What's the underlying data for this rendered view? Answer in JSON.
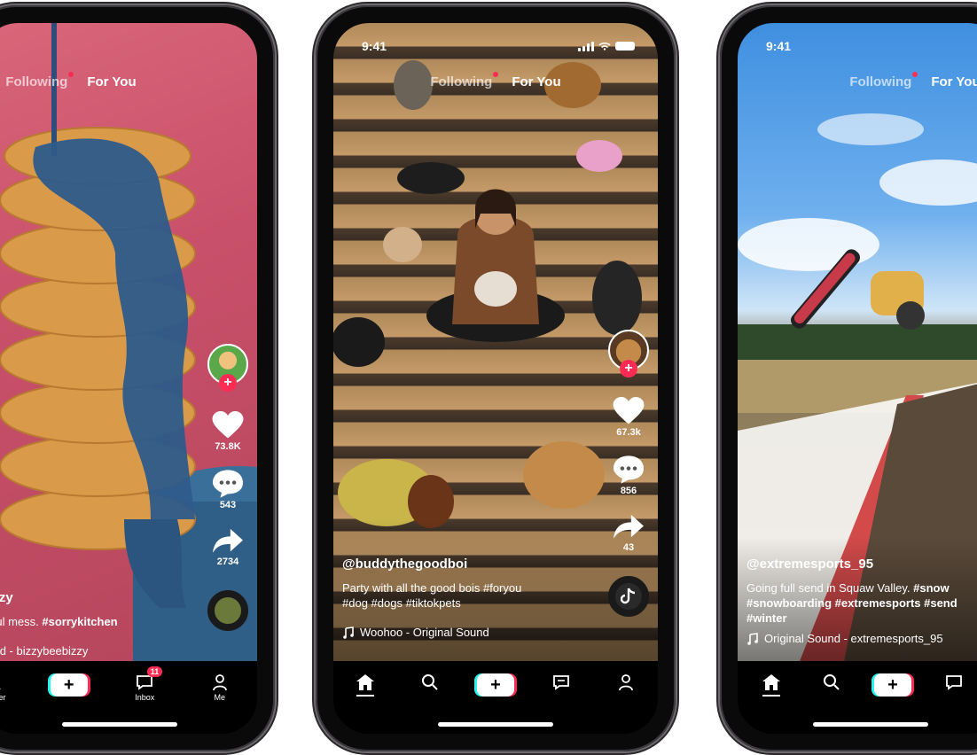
{
  "phones": [
    {
      "nav": {
        "following": "Following",
        "for_you": "For You"
      },
      "rail": {
        "likes": "73.8K",
        "comments": "543",
        "shares": "2734"
      },
      "caption": {
        "handle": "bizzy",
        "text": "utiful mess. ",
        "tags": "#sorrykitchen",
        "sound": "ound - bizzybeebizzy"
      },
      "tabs": {
        "discover": "iscover",
        "inbox": "Inbox",
        "inbox_badge": "11",
        "me": "Me"
      }
    },
    {
      "status": {
        "time": "9:41"
      },
      "nav": {
        "following": "Following",
        "for_you": "For You"
      },
      "rail": {
        "likes": "67.3k",
        "comments": "856",
        "shares": "43"
      },
      "caption": {
        "handle": "@buddythegoodboi",
        "text": "Party with all the good bois #foryou",
        "tags": "#dog #dogs #tiktokpets",
        "sound": "Woohoo - Original Sound"
      }
    },
    {
      "status": {
        "time": "9:41"
      },
      "nav": {
        "following": "Following",
        "for_you": "For You"
      },
      "caption": {
        "handle": "@extremesports_95",
        "text": "Going full send in Squaw Valley. ",
        "tags_line1": "#snow",
        "tags_line2": "#snowboarding #extremesports #send",
        "tags_line3": "#winter",
        "sound": "Original Sound - extremesports_95"
      }
    }
  ],
  "colors": {
    "accent": "#fe2c55",
    "cyan": "#25f4ee"
  }
}
